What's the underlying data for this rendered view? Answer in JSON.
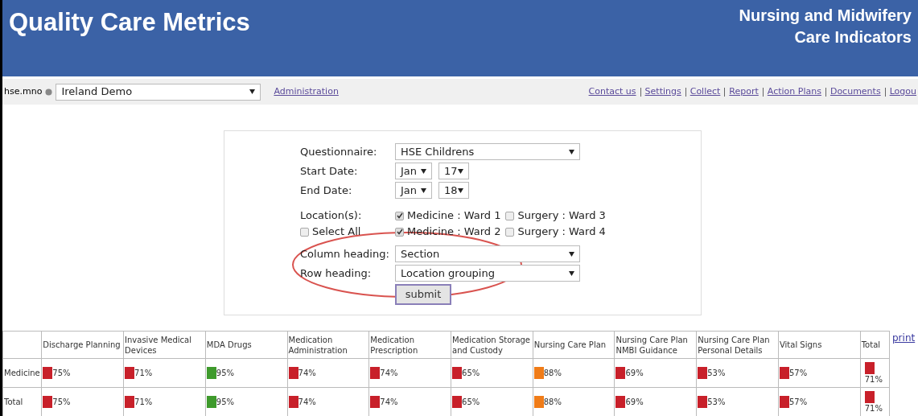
{
  "header": {
    "title": "Quality Care Metrics",
    "subtitle_lines": [
      "Nursing and Midwifery",
      "Care Indicators"
    ]
  },
  "toolbar": {
    "user": "hse.mno",
    "organisation": {
      "value": "Ireland Demo"
    },
    "admin_link": "Administration",
    "links": [
      "Contact us",
      "Settings",
      "Collect",
      "Report",
      "Action Plans",
      "Documents",
      "Logou"
    ]
  },
  "form": {
    "questionnaire": {
      "label": "Questionnaire:",
      "value": "HSE Childrens"
    },
    "start_date": {
      "label": "Start Date:",
      "month": "Jan",
      "day": "17"
    },
    "end_date": {
      "label": "End Date:",
      "month": "Jan",
      "day": "18"
    },
    "locations": {
      "label": "Location(s):",
      "select_all": {
        "label": "Select All",
        "checked": false
      },
      "options": [
        {
          "label": "Medicine : Ward 1",
          "checked": true
        },
        {
          "label": "Surgery : Ward 3",
          "checked": false
        },
        {
          "label": "Medicine : Ward 2",
          "checked": true
        },
        {
          "label": "Surgery : Ward 4",
          "checked": false
        }
      ]
    },
    "column_heading": {
      "label": "Column heading:",
      "value": "Section"
    },
    "row_heading": {
      "label": "Row heading:",
      "value": "Location grouping"
    },
    "submit": "submit"
  },
  "table": {
    "columns": [
      "Discharge Planning",
      "Invasive Medical Devices",
      "MDA Drugs",
      "Medication Administration",
      "Medication Prescription",
      "Medication Storage and Custody",
      "Nursing Care Plan",
      "Nursing Care Plan NMBI Guidance",
      "Nursing Care Plan Personal Details",
      "Vital Signs",
      "Total"
    ],
    "rows": [
      {
        "label": "Medicine",
        "cells": [
          {
            "value": "75%",
            "color": "#c8202a"
          },
          {
            "value": "71%",
            "color": "#c8202a"
          },
          {
            "value": "95%",
            "color": "#3e9a2c"
          },
          {
            "value": "74%",
            "color": "#c8202a"
          },
          {
            "value": "74%",
            "color": "#c8202a"
          },
          {
            "value": "65%",
            "color": "#c8202a"
          },
          {
            "value": "88%",
            "color": "#f07c18"
          },
          {
            "value": "69%",
            "color": "#c8202a"
          },
          {
            "value": "53%",
            "color": "#c8202a"
          },
          {
            "value": "57%",
            "color": "#c8202a"
          },
          {
            "value": "71%",
            "color": "#c8202a"
          }
        ]
      },
      {
        "label": "Total",
        "cells": [
          {
            "value": "75%",
            "color": "#c8202a"
          },
          {
            "value": "71%",
            "color": "#c8202a"
          },
          {
            "value": "95%",
            "color": "#3e9a2c"
          },
          {
            "value": "74%",
            "color": "#c8202a"
          },
          {
            "value": "74%",
            "color": "#c8202a"
          },
          {
            "value": "65%",
            "color": "#c8202a"
          },
          {
            "value": "88%",
            "color": "#f07c18"
          },
          {
            "value": "69%",
            "color": "#c8202a"
          },
          {
            "value": "53%",
            "color": "#c8202a"
          },
          {
            "value": "57%",
            "color": "#c8202a"
          },
          {
            "value": "71%",
            "color": "#c8202a"
          }
        ]
      }
    ]
  },
  "print_link": "print"
}
